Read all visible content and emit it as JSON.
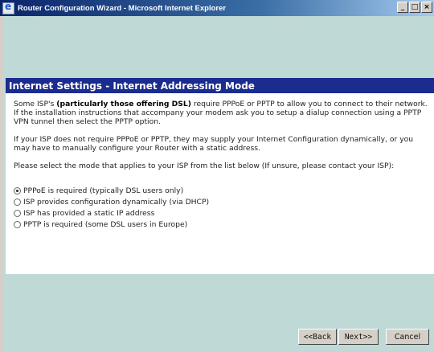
{
  "window": {
    "title": "Router Configuration Wizard - Microsoft Internet Explorer",
    "minimize": "_",
    "maximize": "□",
    "close": "×"
  },
  "panel": {
    "heading": "Internet Settings - Internet Addressing Mode",
    "para1_pre": "Some ISP's ",
    "para1_bold": "(particularly those offering DSL)",
    "para1_post": " require PPPoE or PPTP to allow you to connect to their network. If the installation instructions that accompany your modem ask you to setup a dialup connection using a PPTP VPN tunnel then select the PPTP option.",
    "para2": "If your ISP does not require PPPoE or PPTP, they may supply your Internet Configuration dynamically, or you may have to manually configure your Router with a static address.",
    "para3": "Please select the mode that applies to your ISP from the list below (If unsure, please contact your ISP):",
    "options": [
      {
        "label": "PPPoE is required (typically DSL users only)",
        "selected": true
      },
      {
        "label": "ISP provides configuration dynamically (via DHCP)",
        "selected": false
      },
      {
        "label": "ISP has provided a static IP address",
        "selected": false
      },
      {
        "label": "PPTP is required (some DSL users in Europe)",
        "selected": false
      }
    ]
  },
  "buttons": {
    "back": "<<Back",
    "next": "Next>>",
    "cancel": "Cancel"
  }
}
